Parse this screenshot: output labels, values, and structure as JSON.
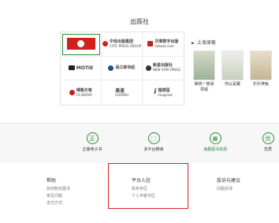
{
  "section_title": "出版社",
  "publishers": [
    {
      "name": "publisher-logo-1",
      "text": "",
      "style": "red"
    },
    {
      "name": "publisher-logo-2",
      "text": "中信出版集团",
      "sub": "CITIC PRESS GROUP"
    },
    {
      "name": "publisher-logo-3",
      "text": "华章数字出版",
      "sub": "hzbook.com"
    },
    {
      "name": "publisher-logo-4",
      "text": "MOTIE",
      "sub": ""
    },
    {
      "name": "publisher-logo-5",
      "text": "長江新世紀",
      "sub": ""
    },
    {
      "name": "publisher-logo-6",
      "text": "新星出版社",
      "sub": "NEW STAR PRESS"
    },
    {
      "name": "publisher-logo-7",
      "text": "博集天卷",
      "sub": "CS BOOKY"
    },
    {
      "name": "publisher-logo-8",
      "text": "果麦",
      "sub": "GUOMAI"
    },
    {
      "name": "publisher-logo-9",
      "text": "理想国",
      "sub": "imaginist"
    }
  ],
  "recommend": {
    "title": "上海读客",
    "books": [
      {
        "caption": "做统一简易领域"
      },
      {
        "caption": "何以是翼"
      },
      {
        "caption": "杉杉神兔"
      }
    ]
  },
  "features": [
    {
      "label": "正版电子书",
      "icon": "正"
    },
    {
      "label": "多平台畅读",
      "icon": "⬚"
    },
    {
      "label": "海量图书资源",
      "icon": "▦"
    },
    {
      "label": "优质",
      "icon": "优"
    }
  ],
  "footer": {
    "help": {
      "title": "帮助",
      "links": [
        "如何购买图书",
        "常见问题",
        "支付方式"
      ]
    },
    "platform": {
      "title": "平台入驻",
      "links": [
        "机构专区",
        "个人作者专区"
      ]
    },
    "feedback": {
      "title": "投诉与建议",
      "links": [
        "问题反馈"
      ]
    }
  },
  "colors": {
    "accent": "#2e8a39",
    "highlight": "#d8201f"
  }
}
